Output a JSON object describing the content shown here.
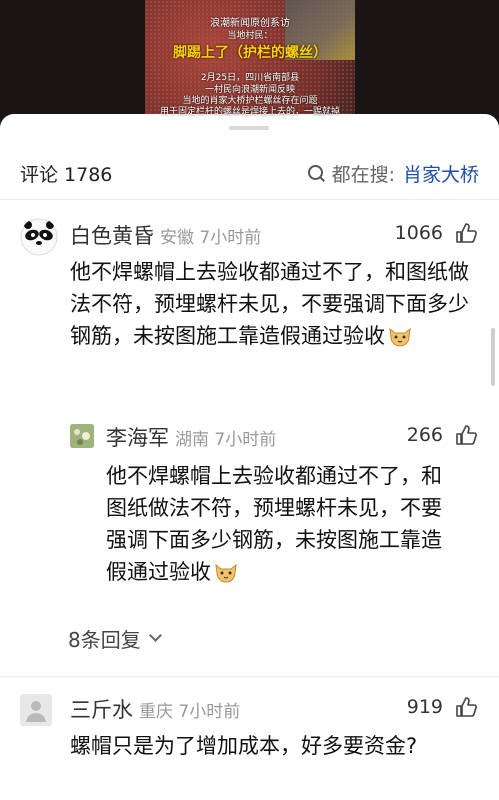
{
  "video": {
    "line1": "浪潮新闻原创系访",
    "line2": "当地村民：",
    "headline": "脚踢上了（护栏的螺丝）",
    "line4": "2月25日，四川省南部县",
    "line5": "一村民向浪潮新闻反映",
    "line6": "当地的肖家大桥护栏螺丝存在问题",
    "line7": "用于固定栏杆的螺丝是焊接上去的，一踢就掉"
  },
  "header": {
    "comment_count_label": "评论 1786",
    "search_prefix": "都在搜:",
    "search_term": "肖家大桥"
  },
  "comments": [
    {
      "user": "白色黄昏",
      "region": "安徽 7小时前",
      "likes": "1066",
      "text": "他不焊螺帽上去验收都通过不了，和图纸做法不符，预埋螺杆未见，不要强调下面多少钢筋，未按图施工靠造假通过验收"
    },
    {
      "user": "李海军",
      "region": "湖南 7小时前",
      "likes": "266",
      "text": "他不焊螺帽上去验收都通过不了，和图纸做法不符，预埋螺杆未见，不要强调下面多少钢筋，未按图施工靠造假通过验收"
    },
    {
      "user": "三斤水",
      "region": "重庆 7小时前",
      "likes": "919",
      "text": "螺帽只是为了增加成本，好多要资金?"
    }
  ],
  "replies": {
    "more_label": "8条回复"
  },
  "icons": {
    "like": "thumbs-up-icon",
    "search": "search-icon",
    "emoji": "cat-face-emoji"
  }
}
